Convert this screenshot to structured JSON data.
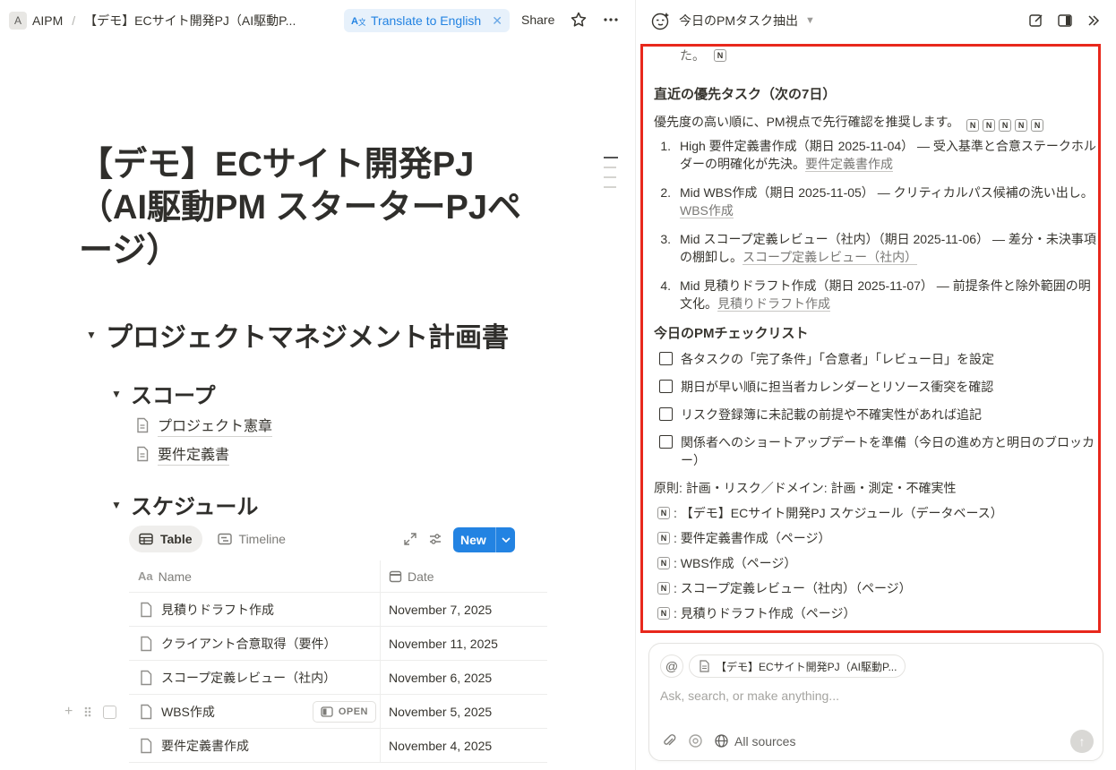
{
  "topbar": {
    "workspace_initial": "A",
    "breadcrumb_root": "AIPM",
    "breadcrumb_page": "【デモ】ECサイト開発PJ（AI駆動P...",
    "translate_label": "Translate to English",
    "share_label": "Share"
  },
  "page": {
    "title_line1": "【デモ】ECサイト開発PJ",
    "title_line2": "（AI駆動PM スターターPJペ",
    "title_line3": "ージ）",
    "section_title": "プロジェクトマネジメント計画書",
    "scope_heading": "スコープ",
    "scope_links": [
      "プロジェクト憲章",
      "要件定義書"
    ],
    "schedule_heading": "スケジュール"
  },
  "database": {
    "tabs": [
      {
        "label": "Table",
        "icon": "table-icon",
        "active": true
      },
      {
        "label": "Timeline",
        "icon": "timeline-icon",
        "active": false
      }
    ],
    "new_label": "New",
    "columns": {
      "name": "Name",
      "date": "Date"
    },
    "rows": [
      {
        "name": "見積りドラフト作成",
        "date": "November 7, 2025"
      },
      {
        "name": "クライアント合意取得（要件）",
        "date": "November 11, 2025"
      },
      {
        "name": "スコープ定義レビュー（社内）",
        "date": "November 6, 2025"
      },
      {
        "name": "WBS作成",
        "date": "November 5, 2025"
      },
      {
        "name": "要件定義書作成",
        "date": "November 4, 2025"
      }
    ],
    "open_label": "OPEN"
  },
  "ai_panel": {
    "title": "今日のPMタスク抽出",
    "top_fragment": "た。",
    "priority_heading": "直近の優先タスク（次の7日）",
    "priority_intro": "優先度の高い順に、PM視点で先行確認を推奨します。",
    "tasks": [
      {
        "num": "1.",
        "text": "High 要件定義書作成（期日 2025-11-04） — 受入基準と合意ステークホルダーの明確化が先決。",
        "link": "要件定義書作成"
      },
      {
        "num": "2.",
        "text": "Mid WBS作成（期日 2025-11-05） — クリティカルパス候補の洗い出し。",
        "link": "WBS作成"
      },
      {
        "num": "3.",
        "text": "Mid スコープ定義レビュー（社内）（期日 2025-11-06） — 差分・未決事項の棚卸し。",
        "link": "スコープ定義レビュー（社内）"
      },
      {
        "num": "4.",
        "text": "Mid 見積りドラフト作成（期日 2025-11-07） — 前提条件と除外範囲の明文化。",
        "link": "見積りドラフト作成"
      }
    ],
    "checklist_heading": "今日のPMチェックリスト",
    "checklist": [
      "各タスクの「完了条件」「合意者」「レビュー日」を設定",
      "期日が早い順に担当者カレンダーとリソース衝突を確認",
      "リスク登録簿に未記載の前提や不確実性があれば追記",
      "関係者へのショートアップデートを準備（今日の進め方と明日のブロッカー）"
    ],
    "principle": "原則: 計画・リスク／ドメイン: 計画・測定・不確実性",
    "references": [
      ": 【デモ】ECサイト開発PJ スケジュール（データベース）",
      ": 要件定義書作成（ページ）",
      ": WBS作成（ページ）",
      ": スコープ定義レビュー（社内）（ページ）",
      ": 見積りドラフト作成（ページ）"
    ],
    "notion_glyph": "N"
  },
  "composer": {
    "at_symbol": "@",
    "context_chip": "【デモ】ECサイト開発PJ（AI駆動P...",
    "placeholder": "Ask, search, or make anything...",
    "sources_label": "All sources"
  },
  "colors": {
    "accent": "#2383e2",
    "highlight_border": "#e8281c"
  }
}
